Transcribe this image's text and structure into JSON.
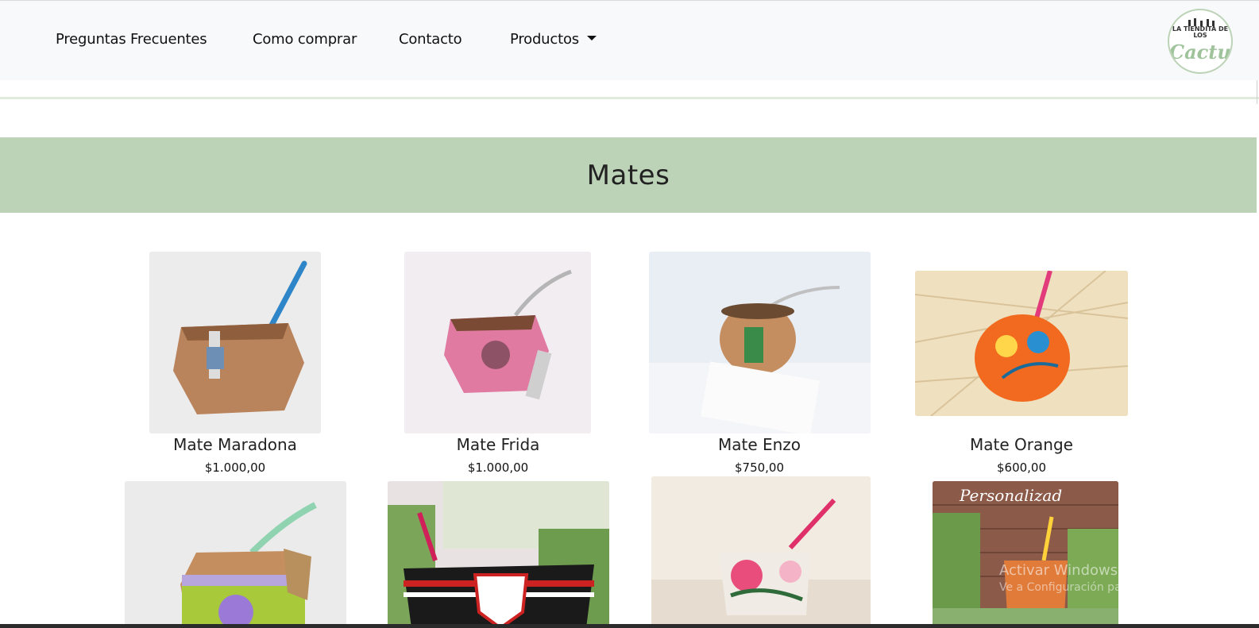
{
  "nav": {
    "items": [
      "Preguntas Frecuentes",
      "Como comprar",
      "Contacto"
    ],
    "products_label": "Productos",
    "logo": {
      "top_text": "LA TIENDITA DE LOS",
      "main_text": "Cactus"
    }
  },
  "banner": {
    "title": "Mates"
  },
  "products": [
    {
      "name": "Mate Maradona",
      "price": "$1.000,00"
    },
    {
      "name": "Mate Frida",
      "price": "$1.000,00"
    },
    {
      "name": "Mate Enzo",
      "price": "$750,00"
    },
    {
      "name": "Mate Orange",
      "price": "$600,00"
    }
  ],
  "second_row_overlay": {
    "personalizados": "Personalizad"
  },
  "watermark": {
    "title": "Activar Windows",
    "subtitle": "Ve a Configuración para activar Windows."
  },
  "colors": {
    "banner": "#bcd3b7",
    "navbar": "#f8f9fa"
  }
}
